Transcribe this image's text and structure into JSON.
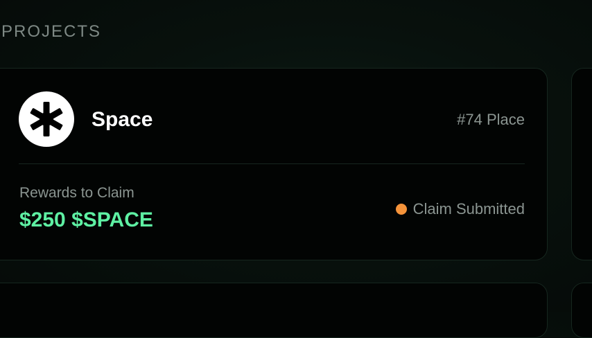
{
  "section": {
    "title": "PROJECTS"
  },
  "project": {
    "name": "Space",
    "logo_icon": "asterisk-burst-icon",
    "place": "#74 Place",
    "rewards_label": "Rewards to Claim",
    "rewards_value": "$250 $SPACE",
    "status_text": "Claim Submitted",
    "status_color": "#f5933a"
  },
  "colors": {
    "accent_green": "#5ef0a3",
    "card_background": "#020403",
    "card_border": "#16271f",
    "muted_text": "#8b9591"
  }
}
